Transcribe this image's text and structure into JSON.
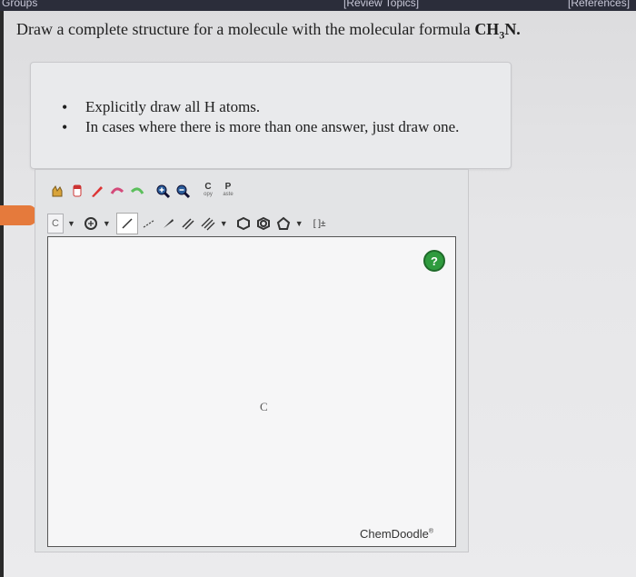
{
  "topbar": {
    "left": "Groups",
    "middle": "[Review Topics]",
    "right": "[References]"
  },
  "question": {
    "text_before": "Draw a complete structure for a molecule with the molecular formula ",
    "formula": "CH",
    "sub": "3",
    "formula_end": "N."
  },
  "instructions": [
    "Explicitly draw all H atoms.",
    "In cases where there is more than one answer, just draw one."
  ],
  "toolbar": {
    "copy_label": "C",
    "copy_sub": "opy",
    "paste_label": "P",
    "paste_sub": "aste",
    "element_select": "C",
    "charge_label": "[ ]±"
  },
  "canvas": {
    "help_label": "?",
    "atom_label": "C",
    "brand": "ChemDoodle",
    "brand_mark": "®"
  }
}
